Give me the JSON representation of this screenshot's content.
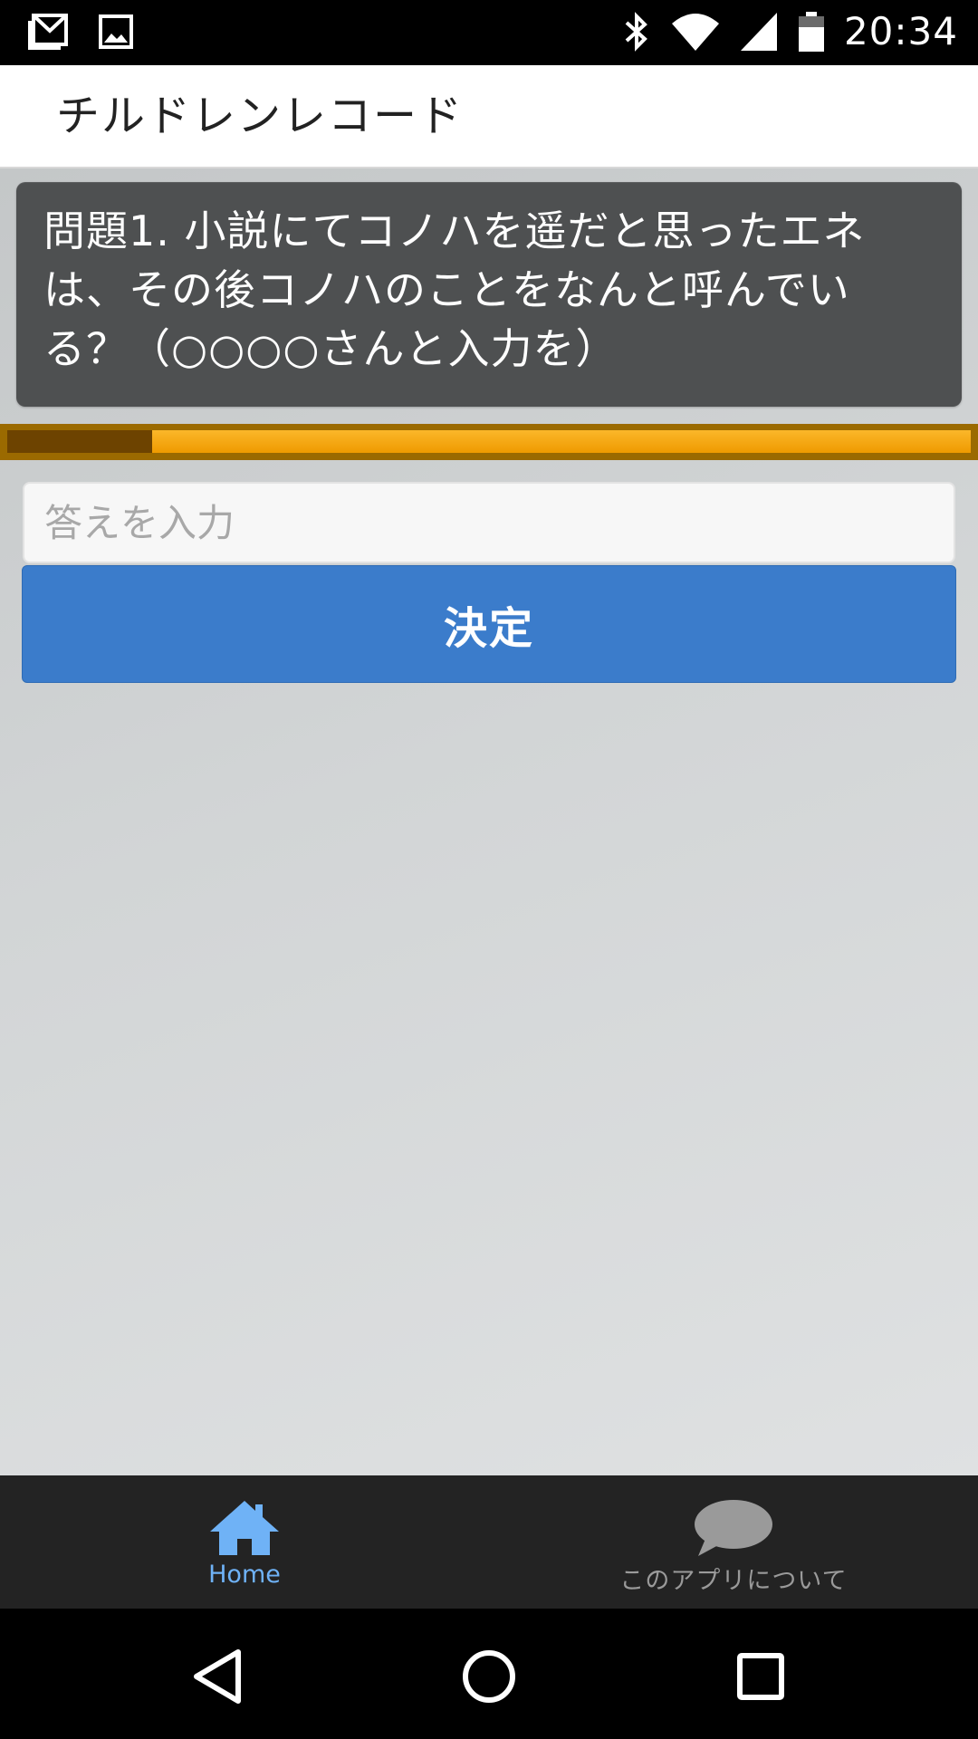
{
  "status_bar": {
    "time": "20:34",
    "icons": [
      "gmail-icon",
      "image-icon",
      "bluetooth-icon",
      "wifi-icon",
      "signal-icon",
      "battery-icon"
    ]
  },
  "header": {
    "title": "チルドレンレコード"
  },
  "question": {
    "text": "問題1. 小説にてコノハを遥だと思ったエネは、その後コノハのことをなんと呼んでいる？（○○○○さんと入力を）"
  },
  "progress": {
    "fraction": 0.15,
    "colors": {
      "track": "#9b6a00",
      "bar": "#f5a500",
      "fill": "#6d4300"
    }
  },
  "answer": {
    "value": "",
    "placeholder": "答えを入力"
  },
  "submit": {
    "label": "決定",
    "color": "#3b7ccb"
  },
  "tabs": [
    {
      "label": "Home",
      "icon": "home-icon",
      "active": true,
      "color": "#6fb2f6"
    },
    {
      "label": "このアプリについて",
      "icon": "chat-bubble-icon",
      "active": false,
      "color": "#9a9a9a"
    }
  ],
  "nav_bar": {
    "icons": [
      "back-icon",
      "home-circle-icon",
      "recents-icon"
    ]
  }
}
